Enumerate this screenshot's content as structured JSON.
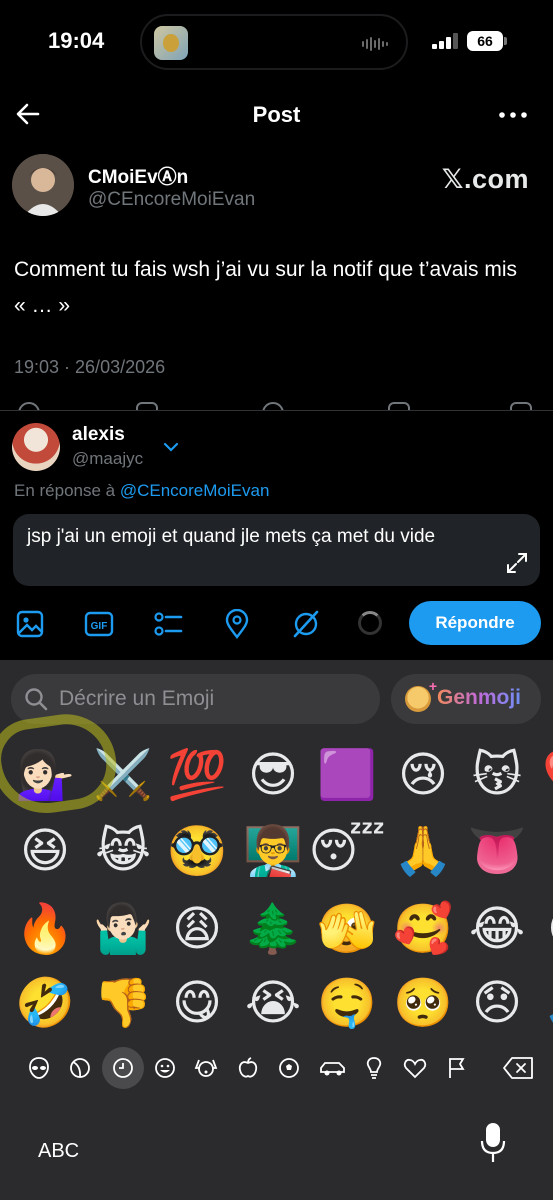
{
  "status_bar": {
    "time": "19:04",
    "battery": "66"
  },
  "header": {
    "title": "Post"
  },
  "post": {
    "author_name": "CMoiEvⒶn",
    "author_handle": "@CEncoreMoiEvan",
    "source_badge": "𝕏.com",
    "text": "Comment tu fais wsh j’ai vu sur la notif que t’avais mis « … »",
    "meta": "19:03 · 26/03/2026"
  },
  "reply": {
    "name": "alexis",
    "handle": "@maajyc",
    "in_reply_prefix": "En réponse à ",
    "in_reply_mention": "@CEncoreMoiEvan",
    "draft_text": "jsp j'ai un emoji et quand jle mets ça met du vide",
    "submit_label": "Répondre"
  },
  "keyboard": {
    "search_placeholder": "Décrire un Emoji",
    "genmoji_label": "Genmoji",
    "abc_label": "ABC",
    "emoji_rows": [
      [
        "💁🏻‍♀️",
        "⚔️",
        "💯",
        "😎",
        "🟪",
        "😢",
        "😽",
        "❤️"
      ],
      [
        "😆",
        "😹",
        "🥸",
        "👨‍🏫",
        "😴",
        "🙏",
        "👅",
        "👌"
      ],
      [
        "🔥",
        "🤷🏻‍♂️",
        "😩",
        "🌲",
        "🫣",
        "🥰",
        "😂",
        "😍"
      ],
      [
        "🤣",
        "👎",
        "😋",
        "😭",
        "🤤",
        "🥺",
        "😞",
        "🙏"
      ]
    ],
    "categories": [
      "alien-face-icon",
      "moon-icon",
      "clock-icon",
      "smiley-icon",
      "dog-icon",
      "apple-icon",
      "soccer-ball-icon",
      "car-icon",
      "lightbulb-icon",
      "heart-icon",
      "flag-icon"
    ]
  },
  "colors": {
    "accent": "#1d9bf0",
    "muted": "#71767b",
    "keyboard_bg": "#2b2b2d"
  }
}
